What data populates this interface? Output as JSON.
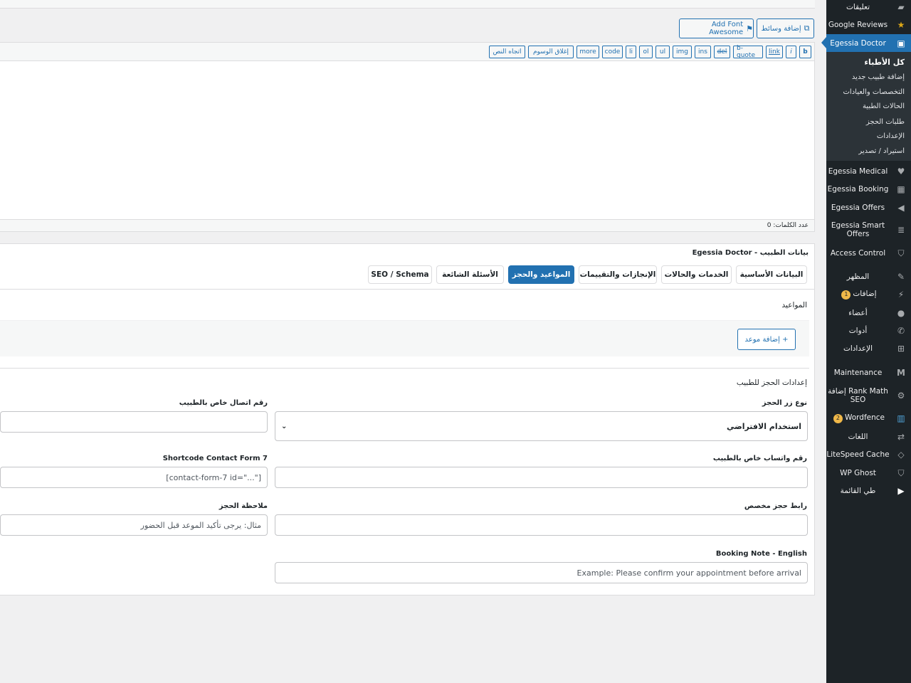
{
  "sidebar": {
    "menu_top": [
      {
        "label": "تعليقات",
        "icon": "comment-icon"
      },
      {
        "label": "Google Reviews",
        "icon": "star-icon"
      },
      {
        "label": "Egessia Doctor",
        "icon": "doctor-icon"
      }
    ],
    "submenu": [
      "كل الأطباء",
      "إضافة طبيب جديد",
      "التخصصات والعيادات",
      "الحالات الطبية",
      "طلبات الحجز",
      "الإعدادات",
      "استيراد / تصدير"
    ],
    "menu_bottom": [
      {
        "label": "Egessia Medical",
        "icon": "heart-icon"
      },
      {
        "label": "Egessia Booking",
        "icon": "calendar-icon"
      },
      {
        "label": "Egessia Offers",
        "icon": "megaphone-icon"
      },
      {
        "label": "Egessia Smart Offers",
        "icon": "stack-icon"
      },
      {
        "label": "Access Control",
        "icon": "shield-icon"
      },
      {
        "label": "المظهر",
        "icon": "brush-icon"
      },
      {
        "label": "إضافات",
        "icon": "plugin-icon",
        "badge": "1"
      },
      {
        "label": "أعضاء",
        "icon": "user-icon"
      },
      {
        "label": "أدوات",
        "icon": "wrench-icon"
      },
      {
        "label": "الإعدادات",
        "icon": "settings-icon"
      },
      {
        "label": "Maintenance",
        "icon": "maintenance-icon"
      },
      {
        "label": "Rank Math إضافة SEO",
        "icon": "gear-icon"
      },
      {
        "label": "Wordfence",
        "icon": "wordfence-icon",
        "badge": "2"
      },
      {
        "label": "اللغات",
        "icon": "translate-icon"
      },
      {
        "label": "LiteSpeed Cache",
        "icon": "diamond-icon"
      },
      {
        "label": "WP Ghost",
        "icon": "shield-icon"
      },
      {
        "label": "طي القائمة",
        "icon": "collapse-icon"
      }
    ]
  },
  "editor": {
    "add_media": "إضافة وسائط",
    "add_font_awesome": "Add Font Awesome",
    "quicktags": [
      "b",
      "i",
      "link",
      "b-quote",
      "del",
      "ins",
      "img",
      "ul",
      "ol",
      "li",
      "code",
      "more",
      "إغلاق الوسوم",
      "اتجاه النص"
    ],
    "word_count": "عدد الكلمات: 0"
  },
  "metabox": {
    "title": "بيانات الطبيب - Egessia Doctor",
    "tabs": [
      "البيانات الأساسية",
      "الخدمات والحالات",
      "الإنجازات والتقييمات",
      "المواعيد والحجز",
      "الأسئلة الشائعة",
      "SEO / Schema"
    ],
    "active_tab": "المواعيد والحجز",
    "schedule_heading": "المواعيد",
    "add_slot": "+ إضافة موعد",
    "booking_heading": "إعدادات الحجز للطبيب",
    "fields": {
      "booking_type_label": "نوع زر الحجز",
      "booking_type_value": "استخدام الافتراضي",
      "phone_label": "رقم اتصال خاص بالطبيب",
      "whatsapp_label": "رقم واتساب خاص بالطبيب",
      "shortcode_label": "Shortcode Contact Form 7",
      "shortcode_placeholder": "[contact-form-7 id=\"...\"]",
      "custom_link_label": "رابط حجز مخصص",
      "note_label": "ملاحظة الحجز",
      "note_placeholder": "مثال: يرجى تأكيد الموعد قبل الحضور",
      "note_en_label": "Booking Note - English",
      "note_en_placeholder": "Example: Please confirm your appointment before arrival"
    }
  }
}
